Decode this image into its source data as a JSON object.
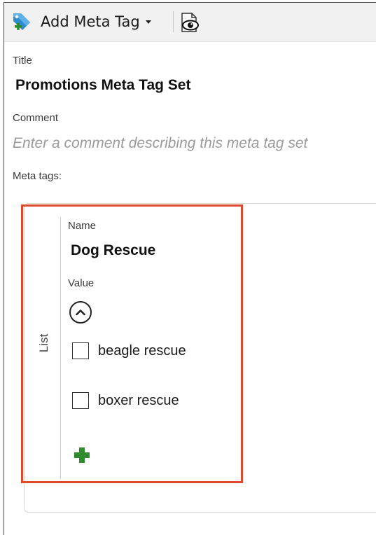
{
  "toolbar": {
    "add_meta_tag_label": "Add Meta Tag",
    "add_meta_tag_icon": "tag-add-icon",
    "dropdown_icon": "caret-down-icon",
    "preview_icon": "preview-document-icon"
  },
  "form": {
    "title_label": "Title",
    "title_value": "Promotions Meta Tag Set",
    "comment_label": "Comment",
    "comment_placeholder": "Enter a comment describing this meta tag set",
    "comment_value": "",
    "meta_tags_label": "Meta tags:"
  },
  "meta_tag": {
    "type_label": "List",
    "name_label": "Name",
    "name_value": "Dog Rescue",
    "value_label": "Value",
    "collapse_icon": "chevron-up-circle-icon",
    "options": [
      {
        "label": "beagle rescue",
        "checked": false
      },
      {
        "label": "boxer rescue",
        "checked": false
      }
    ],
    "add_icon": "plus-icon"
  },
  "colors": {
    "highlight_border": "#e04a2c",
    "add_icon_green": "#2e8b2e",
    "tag_icon_blue": "#2f8ccf"
  }
}
